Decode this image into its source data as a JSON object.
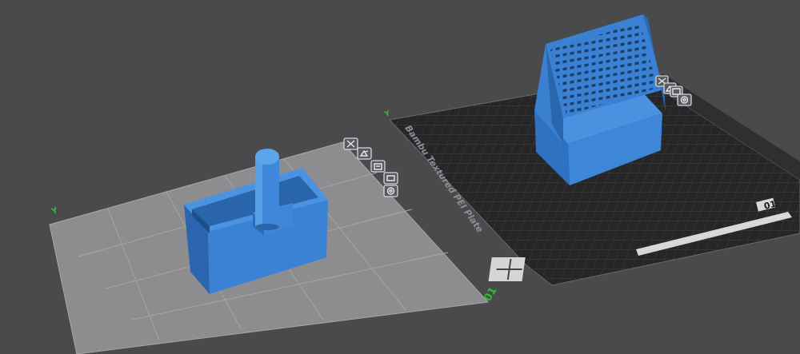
{
  "scene": {
    "plate_1": {
      "number_label": "01",
      "origin_label": "Y",
      "toolbar": [
        "close-icon",
        "arrange-icon",
        "lock-icon",
        "settings-icon"
      ]
    },
    "plate_2": {
      "number_label": "01",
      "origin_label": "Y",
      "plate_name": "Bambu Textured PEI Plate",
      "toolbar": [
        "close-icon",
        "arrange-icon",
        "lock-icon",
        "settings-icon"
      ]
    }
  }
}
